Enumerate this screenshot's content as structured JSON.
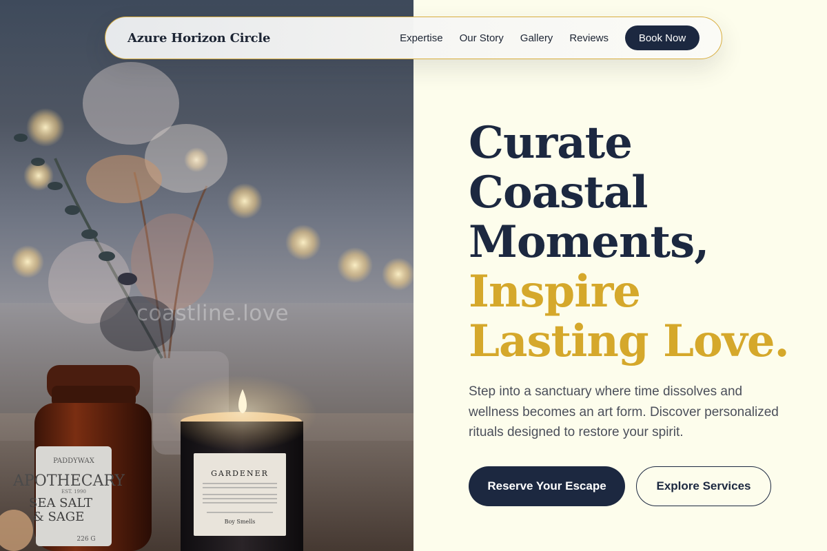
{
  "nav": {
    "brand": "Azure Horizon Circle",
    "links": [
      "Expertise",
      "Our Story",
      "Gallery",
      "Reviews"
    ],
    "cta": "Book Now"
  },
  "hero": {
    "title_lines": [
      "Curate",
      "Coastal",
      "Moments,"
    ],
    "accent_lines": [
      "Inspire",
      "Lasting Love."
    ],
    "description": "Step into a sanctuary where time dissolves and wellness becomes an art form. Discover personalized rituals designed to restore your spirit.",
    "primary_cta": "Reserve Your Escape",
    "secondary_cta": "Explore Services"
  },
  "photo": {
    "watermark": "coastline.love",
    "jar_label": {
      "brand": "PADDYWAX",
      "line": "APOTHECARY",
      "est": "EST. 1990",
      "scent_1": "SEA SALT",
      "scent_2": "& SAGE",
      "weight": "226 G"
    },
    "candle_label": {
      "title": "GARDENER",
      "footer": "Boy   Smells"
    }
  },
  "colors": {
    "navy": "#1c2840",
    "gold": "#d5a82b",
    "cream": "#fdfdec"
  }
}
